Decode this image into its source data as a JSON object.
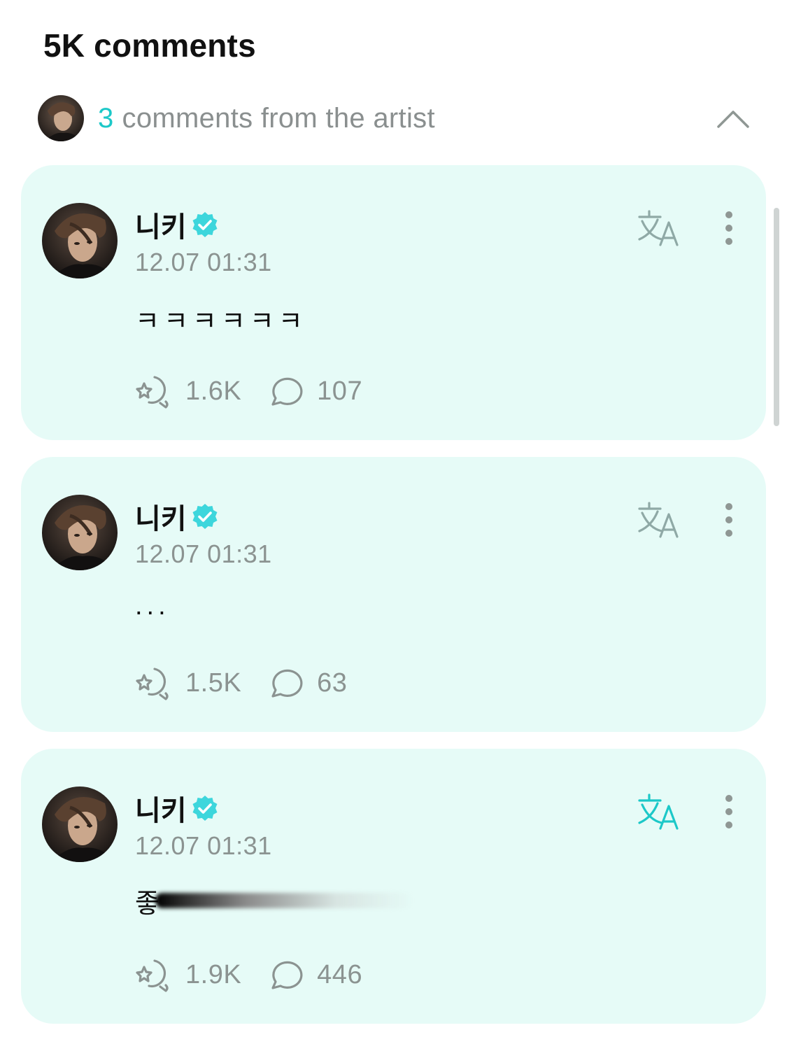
{
  "header": {
    "comments_count_label": "5K comments"
  },
  "artist_section": {
    "count": "3",
    "label": "comments from the artist",
    "collapse_icon": "chevron-up-icon",
    "accent_color": "#1cc8c8"
  },
  "comments": [
    {
      "author": "니키",
      "verified": true,
      "timestamp": "12.07 01:31",
      "text": "ㅋㅋㅋㅋㅋㅋ",
      "likes": "1.6K",
      "replies": "107",
      "translate_active": false
    },
    {
      "author": "니키",
      "verified": true,
      "timestamp": "12.07 01:31",
      "text": "...",
      "likes": "1.5K",
      "replies": "63",
      "translate_active": false
    },
    {
      "author": "니키",
      "verified": true,
      "timestamp": "12.07 01:31",
      "text": "좋",
      "text_obscured": true,
      "likes": "1.9K",
      "replies": "446",
      "translate_active": true
    }
  ],
  "colors": {
    "card_background": "#e6fbf7",
    "verified_badge": "#3dd6dc",
    "muted_text": "#8b9391",
    "translate_active": "#1cc8c8",
    "translate_inactive": "#8fa9a6"
  },
  "icons": {
    "like": "reaction-like-icon",
    "reply": "speech-bubble-icon",
    "translate": "translate-icon",
    "more": "more-vertical-icon",
    "verified": "verified-badge-icon"
  }
}
